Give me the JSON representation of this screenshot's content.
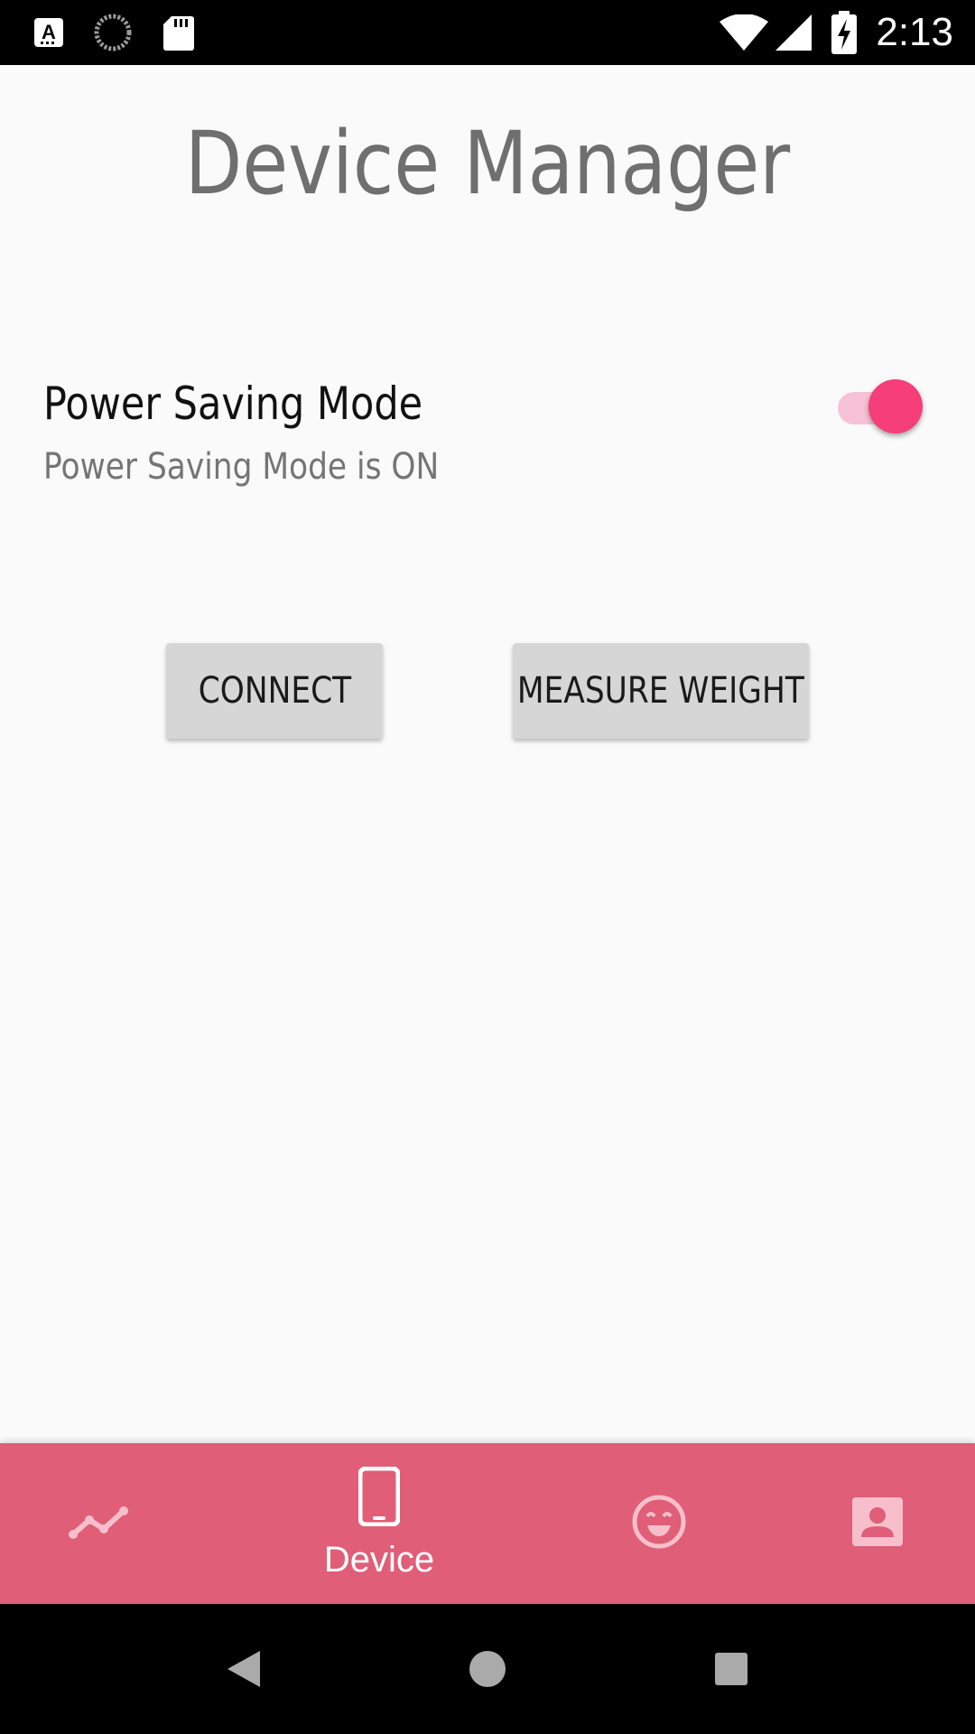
{
  "status_bar": {
    "time": "2:13",
    "left_icons": [
      "keyboard-a-icon",
      "sync-spinner-icon",
      "sd-card-icon"
    ],
    "right_icons": [
      "wifi-icon",
      "cell-signal-icon",
      "battery-charging-icon"
    ]
  },
  "page": {
    "title": "Device Manager"
  },
  "power_saving": {
    "title": "Power Saving Mode",
    "summary": "Power Saving Mode is ON",
    "enabled": true
  },
  "actions": {
    "connect_label": "CONNECT",
    "measure_weight_label": "MEASURE WEIGHT"
  },
  "bottom_nav": {
    "items": [
      {
        "icon": "trend-line-icon",
        "label": ""
      },
      {
        "icon": "phone-device-icon",
        "label": "Device",
        "selected": true
      },
      {
        "icon": "smiley-face-icon",
        "label": ""
      },
      {
        "icon": "profile-card-icon",
        "label": ""
      }
    ]
  },
  "colors": {
    "accent": "#f53e7a",
    "accent_track": "#f8c2d6",
    "nav_background": "#e05e77",
    "title_gray": "#6f6f6f",
    "button_gray": "#d6d6d6"
  },
  "system_nav": {
    "icons": [
      "back-icon",
      "home-icon",
      "recents-icon"
    ]
  }
}
